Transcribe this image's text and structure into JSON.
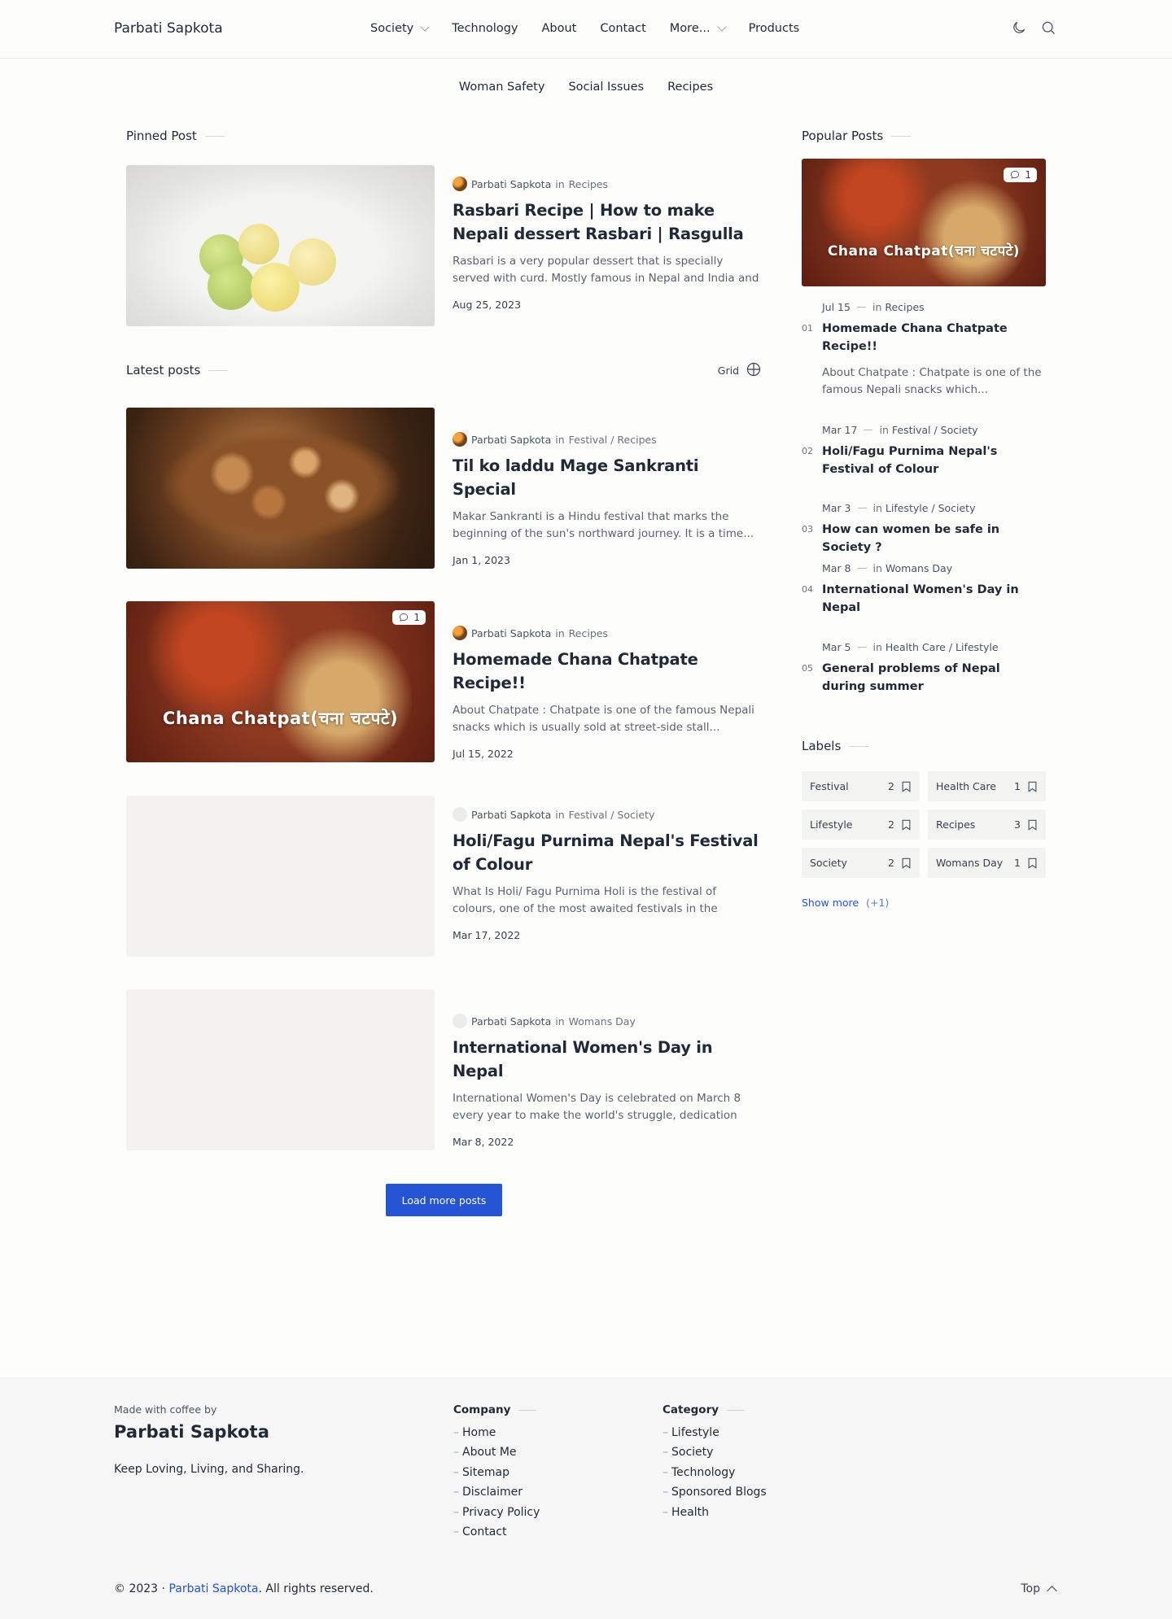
{
  "header": {
    "brand": "Parbati Sapkota",
    "nav": [
      {
        "label": "Society",
        "dropdown": true
      },
      {
        "label": "Technology",
        "dropdown": false
      },
      {
        "label": "About",
        "dropdown": false
      },
      {
        "label": "Contact",
        "dropdown": false
      },
      {
        "label": "More...",
        "dropdown": true
      },
      {
        "label": "Products",
        "dropdown": false
      }
    ],
    "icons": [
      "moon-icon",
      "search-icon"
    ]
  },
  "subnav": [
    "Woman Safety",
    "Social Issues",
    "Recipes"
  ],
  "pinned": {
    "section_title": "Pinned Post",
    "author": "Parbati Sapkota",
    "in": "in",
    "category": "Recipes",
    "title": "Rasbari Recipe | How to make Nepali dessert Rasbari | Rasgulla",
    "excerpt": "Rasbari is a very popular dessert that is specially served with curd. Mostly famous in Nepal and India and is als...",
    "date": "Aug 25, 2023"
  },
  "latest": {
    "section_title": "Latest posts",
    "grid_label": "Grid",
    "posts": [
      {
        "author": "Parbati Sapkota",
        "in": "in",
        "category": "Festival / Recipes",
        "title": "Til ko laddu Mage Sankranti Special",
        "excerpt": "Makar Sankranti is a Hindu festival that marks the beginning of the sun's northward journey. It is a time...",
        "date": "Jan 1, 2023"
      },
      {
        "author": "Parbati Sapkota",
        "in": "in",
        "category": "Recipes",
        "title": "Homemade Chana Chatpate Recipe!!",
        "excerpt": "About Chatpate :   Chatpate   is one of the famous Nepali  snacks which is usually sold at street-side stall...",
        "date": "Jul 15, 2022",
        "comments": "1",
        "image_text": "Chana Chatpat(चना चटपटे)"
      },
      {
        "author": "Parbati Sapkota",
        "in": "in",
        "category": "Festival / Society",
        "title": "Holi/Fagu Purnima Nepal's Festival of Colour",
        "excerpt": "What Is Holi/ Fagu Purnima  Holi is the festival of colours, one of the most awaited festivals in the count...",
        "date": "Mar 17, 2022"
      },
      {
        "author": "Parbati Sapkota",
        "in": "in",
        "category": "Womans Day",
        "title": "International Women's Day in Nepal",
        "excerpt": "International Women's Day is celebrated on March 8 every year to make the world's struggle, dedication to...",
        "date": "Mar 8, 2022"
      }
    ],
    "load_more": "Load more posts"
  },
  "popular": {
    "section_title": "Popular Posts",
    "hero_comments": "1",
    "hero_text": "Chana Chatpat(चना चटपटे)",
    "items": [
      {
        "num": "01",
        "date": "Jul 15",
        "in": "in",
        "category": "Recipes",
        "title": "Homemade Chana Chatpate Recipe!!",
        "excerpt": "About Chatpate :   Chatpate   is one of the famous Nepali  snacks which..."
      },
      {
        "num": "02",
        "date": "Mar 17",
        "in": "in",
        "category": "Festival / Society",
        "title": "Holi/Fagu Purnima Nepal's Festival of Colour"
      },
      {
        "num": "03",
        "date": "Mar 3",
        "in": "in",
        "category": "Lifestyle / Society",
        "title": "How can women be safe in Society ?"
      },
      {
        "num": "04",
        "date": "Mar 8",
        "in": "in",
        "category": "Womans Day",
        "title": "International Women's Day in Nepal"
      },
      {
        "num": "05",
        "date": "Mar 5",
        "in": "in",
        "category": "Health Care / Lifestyle",
        "title": "General problems of Nepal during summer"
      }
    ]
  },
  "labels": {
    "section_title": "Labels",
    "items": [
      {
        "name": "Festival",
        "count": "2"
      },
      {
        "name": "Health Care",
        "count": "1"
      },
      {
        "name": "Lifestyle",
        "count": "2"
      },
      {
        "name": "Recipes",
        "count": "3"
      },
      {
        "name": "Society",
        "count": "2"
      },
      {
        "name": "Womans Day",
        "count": "1"
      }
    ],
    "show_more": "Show more",
    "show_more_count": "(+1)"
  },
  "footer": {
    "small": "Made with coffee by",
    "brand": "Parbati Sapkota",
    "tagline": "Keep Loving, Living, and Sharing.",
    "company_title": "Company",
    "company_links": [
      "Home",
      "About Me",
      "Sitemap",
      "Disclaimer",
      "Privacy Policy",
      "Contact"
    ],
    "category_title": "Category",
    "category_links": [
      "Lifestyle",
      "Society",
      "Technology",
      "Sponsored Blogs",
      "Health"
    ],
    "dash": "–",
    "copyright_prefix": "© 2023 · ",
    "copyright_link": "Parbati Sapkota",
    "copyright_suffix": ". All rights reserved.",
    "top": "Top"
  },
  "colors": {
    "accent": "#2453d4",
    "text": "#1f2937",
    "muted": "#6b7280",
    "footer_bg": "#f6f6f6"
  }
}
